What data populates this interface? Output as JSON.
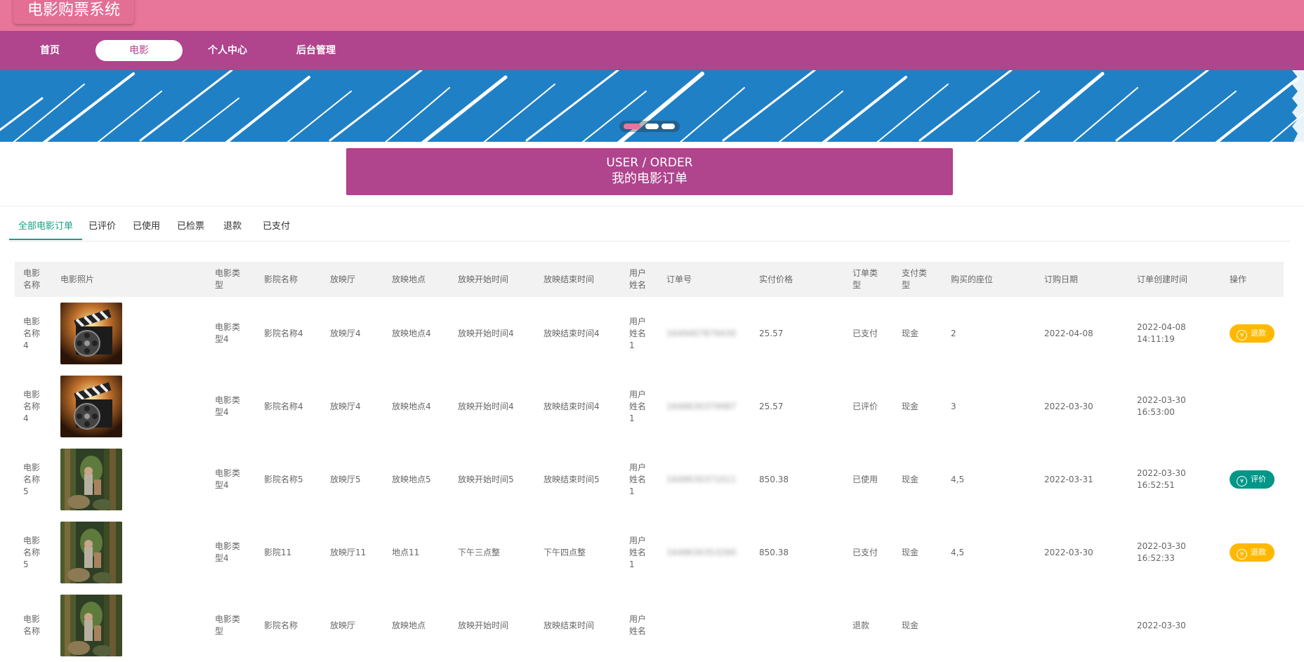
{
  "site": {
    "title": "电影购票系统"
  },
  "nav": [
    {
      "label": "首页",
      "active": false
    },
    {
      "label": "电影",
      "active": true
    },
    {
      "label": "个人中心",
      "active": false
    },
    {
      "label": "后台管理",
      "active": false
    }
  ],
  "section": {
    "title_en": "USER / ORDER",
    "title_cn": "我的电影订单"
  },
  "tabs": [
    {
      "label": "全部电影订单",
      "active": true
    },
    {
      "label": "已评价",
      "active": false
    },
    {
      "label": "已使用",
      "active": false
    },
    {
      "label": "已检票",
      "active": false
    },
    {
      "label": "退款",
      "active": false
    },
    {
      "label": "已支付",
      "active": false
    }
  ],
  "table": {
    "headers": [
      "电影名称",
      "电影照片",
      "电影类型",
      "影院名称",
      "放映厅",
      "放映地点",
      "放映开始时间",
      "放映结束时间",
      "用户姓名",
      "订单号",
      "实付价格",
      "订单类型",
      "支付类型",
      "购买的座位",
      "订购日期",
      "订单创建时间",
      "操作"
    ],
    "rows": [
      {
        "name": "电影名称4",
        "poster": "clapper",
        "type": "电影类型4",
        "cinema": "影院名称4",
        "hall": "放映厅4",
        "place": "放映地点4",
        "start": "放映开始时间4",
        "end": "放映结束时间4",
        "user": "用户姓名1",
        "order_no": "1649407879430",
        "price": "25.57",
        "order_type": "已支付",
        "pay_type": "现金",
        "seats": "2",
        "date": "2022-04-08",
        "created": "2022-04-08 14:11:19",
        "action": "退款",
        "action_kind": "refund"
      },
      {
        "name": "电影名称4",
        "poster": "clapper",
        "type": "电影类型4",
        "cinema": "影院名称4",
        "hall": "放映厅4",
        "place": "放映地点4",
        "start": "放映开始时间4",
        "end": "放映结束时间4",
        "user": "用户姓名1",
        "order_no": "1648630379987",
        "price": "25.57",
        "order_type": "已评价",
        "pay_type": "现金",
        "seats": "3",
        "date": "2022-03-30",
        "created": "2022-03-30 16:53:00",
        "action": "",
        "action_kind": ""
      },
      {
        "name": "电影名称5",
        "poster": "forest",
        "type": "电影类型4",
        "cinema": "影院名称5",
        "hall": "放映厅5",
        "place": "放映地点5",
        "start": "放映开始时间5",
        "end": "放映结束时间5",
        "user": "用户姓名1",
        "order_no": "1648630371011",
        "price": "850.38",
        "order_type": "已使用",
        "pay_type": "现金",
        "seats": "4,5",
        "date": "2022-03-31",
        "created": "2022-03-30 16:52:51",
        "action": "评价",
        "action_kind": "review"
      },
      {
        "name": "电影名称5",
        "poster": "forest",
        "type": "电影类型4",
        "cinema": "影院11",
        "hall": "放映厅11",
        "place": "地点11",
        "start": "下午三点整",
        "end": "下午四点整",
        "user": "用户姓名1",
        "order_no": "1648630353260",
        "price": "850.38",
        "order_type": "已支付",
        "pay_type": "现金",
        "seats": "4,5",
        "date": "2022-03-30",
        "created": "2022-03-30 16:52:33",
        "action": "退款",
        "action_kind": "refund"
      },
      {
        "name": "电影名称",
        "poster": "forest",
        "type": "电影类型",
        "cinema": "影院名称",
        "hall": "放映厅",
        "place": "放映地点",
        "start": "放映开始时间",
        "end": "放映结束时间",
        "user": "用户姓名",
        "order_no": "",
        "price": "",
        "order_type": "退款",
        "pay_type": "现金",
        "seats": "",
        "date": "",
        "created": "2022-03-30",
        "action": "",
        "action_kind": ""
      }
    ]
  },
  "colors": {
    "topbar": "#e8759a",
    "navbar": "#b0448d",
    "banner": "#2080c6",
    "accent": "#16a085",
    "refund": "#ffb800",
    "review": "#009688"
  }
}
